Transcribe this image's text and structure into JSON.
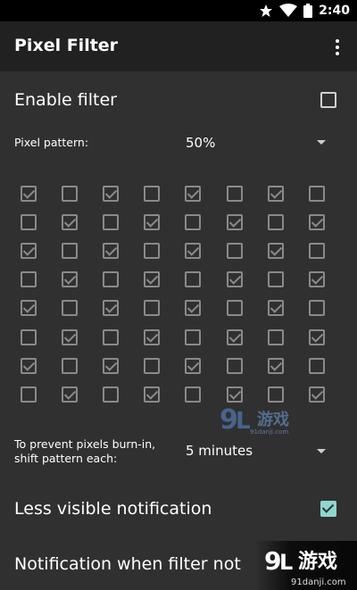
{
  "status_bar": {
    "time": "2:40",
    "icons": [
      "star-icon",
      "wifi-icon",
      "battery-icon"
    ]
  },
  "app_bar": {
    "title": "Pixel Filter",
    "overflow_icon": "more-vert-icon"
  },
  "settings": {
    "enable_filter": {
      "label": "Enable filter",
      "checked": false
    },
    "pixel_pattern": {
      "label": "Pixel pattern:",
      "value": "50%"
    },
    "pattern_grid": {
      "rows": [
        [
          true,
          false,
          true,
          false,
          true,
          false,
          true,
          false
        ],
        [
          false,
          true,
          false,
          true,
          false,
          true,
          false,
          true
        ],
        [
          true,
          false,
          true,
          false,
          true,
          false,
          true,
          false
        ],
        [
          false,
          true,
          false,
          true,
          false,
          true,
          false,
          true
        ],
        [
          true,
          false,
          true,
          false,
          true,
          false,
          true,
          false
        ],
        [
          false,
          true,
          false,
          true,
          false,
          true,
          false,
          true
        ],
        [
          true,
          false,
          true,
          false,
          true,
          false,
          true,
          false
        ],
        [
          false,
          true,
          false,
          true,
          false,
          true,
          false,
          true
        ]
      ]
    },
    "shift_pattern": {
      "label_line1": "To prevent pixels burn-in,",
      "label_line2": "shift pattern each:",
      "value": "5 minutes"
    },
    "less_visible_notification": {
      "label": "Less visible notification",
      "checked": true
    },
    "notification_when_filter": {
      "label": "Notification when filter not"
    }
  },
  "watermark": {
    "logo1_text": "9",
    "logo1_suffix": "游戏",
    "logo1_sub": "91danji.com",
    "logo2_text": "9",
    "logo2_suffix": "游戏",
    "logo2_sub": "91danji.com"
  },
  "colors": {
    "accent": "#8fd6d0",
    "background": "#303030",
    "app_bar": "#212121"
  }
}
